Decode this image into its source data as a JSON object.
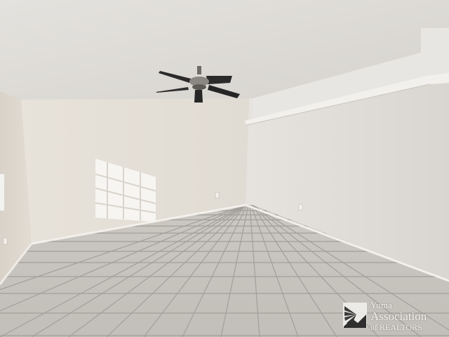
{
  "photo": {
    "subject": "",
    "colors": {
      "ceiling": "#e7e5e1",
      "left_wall": "#e3ddd5",
      "back_wall": "#ece8e2",
      "right_wall": "#e1ddd8",
      "floor_tile": "#c9c6c0",
      "grout": "#9f9c97",
      "fan_blade": "#2a2a2a"
    }
  },
  "watermark": {
    "icon": "mountain-sun-logo-icon",
    "line1": "Yuma",
    "line2": "Association",
    "line3": "of REALTORS"
  }
}
